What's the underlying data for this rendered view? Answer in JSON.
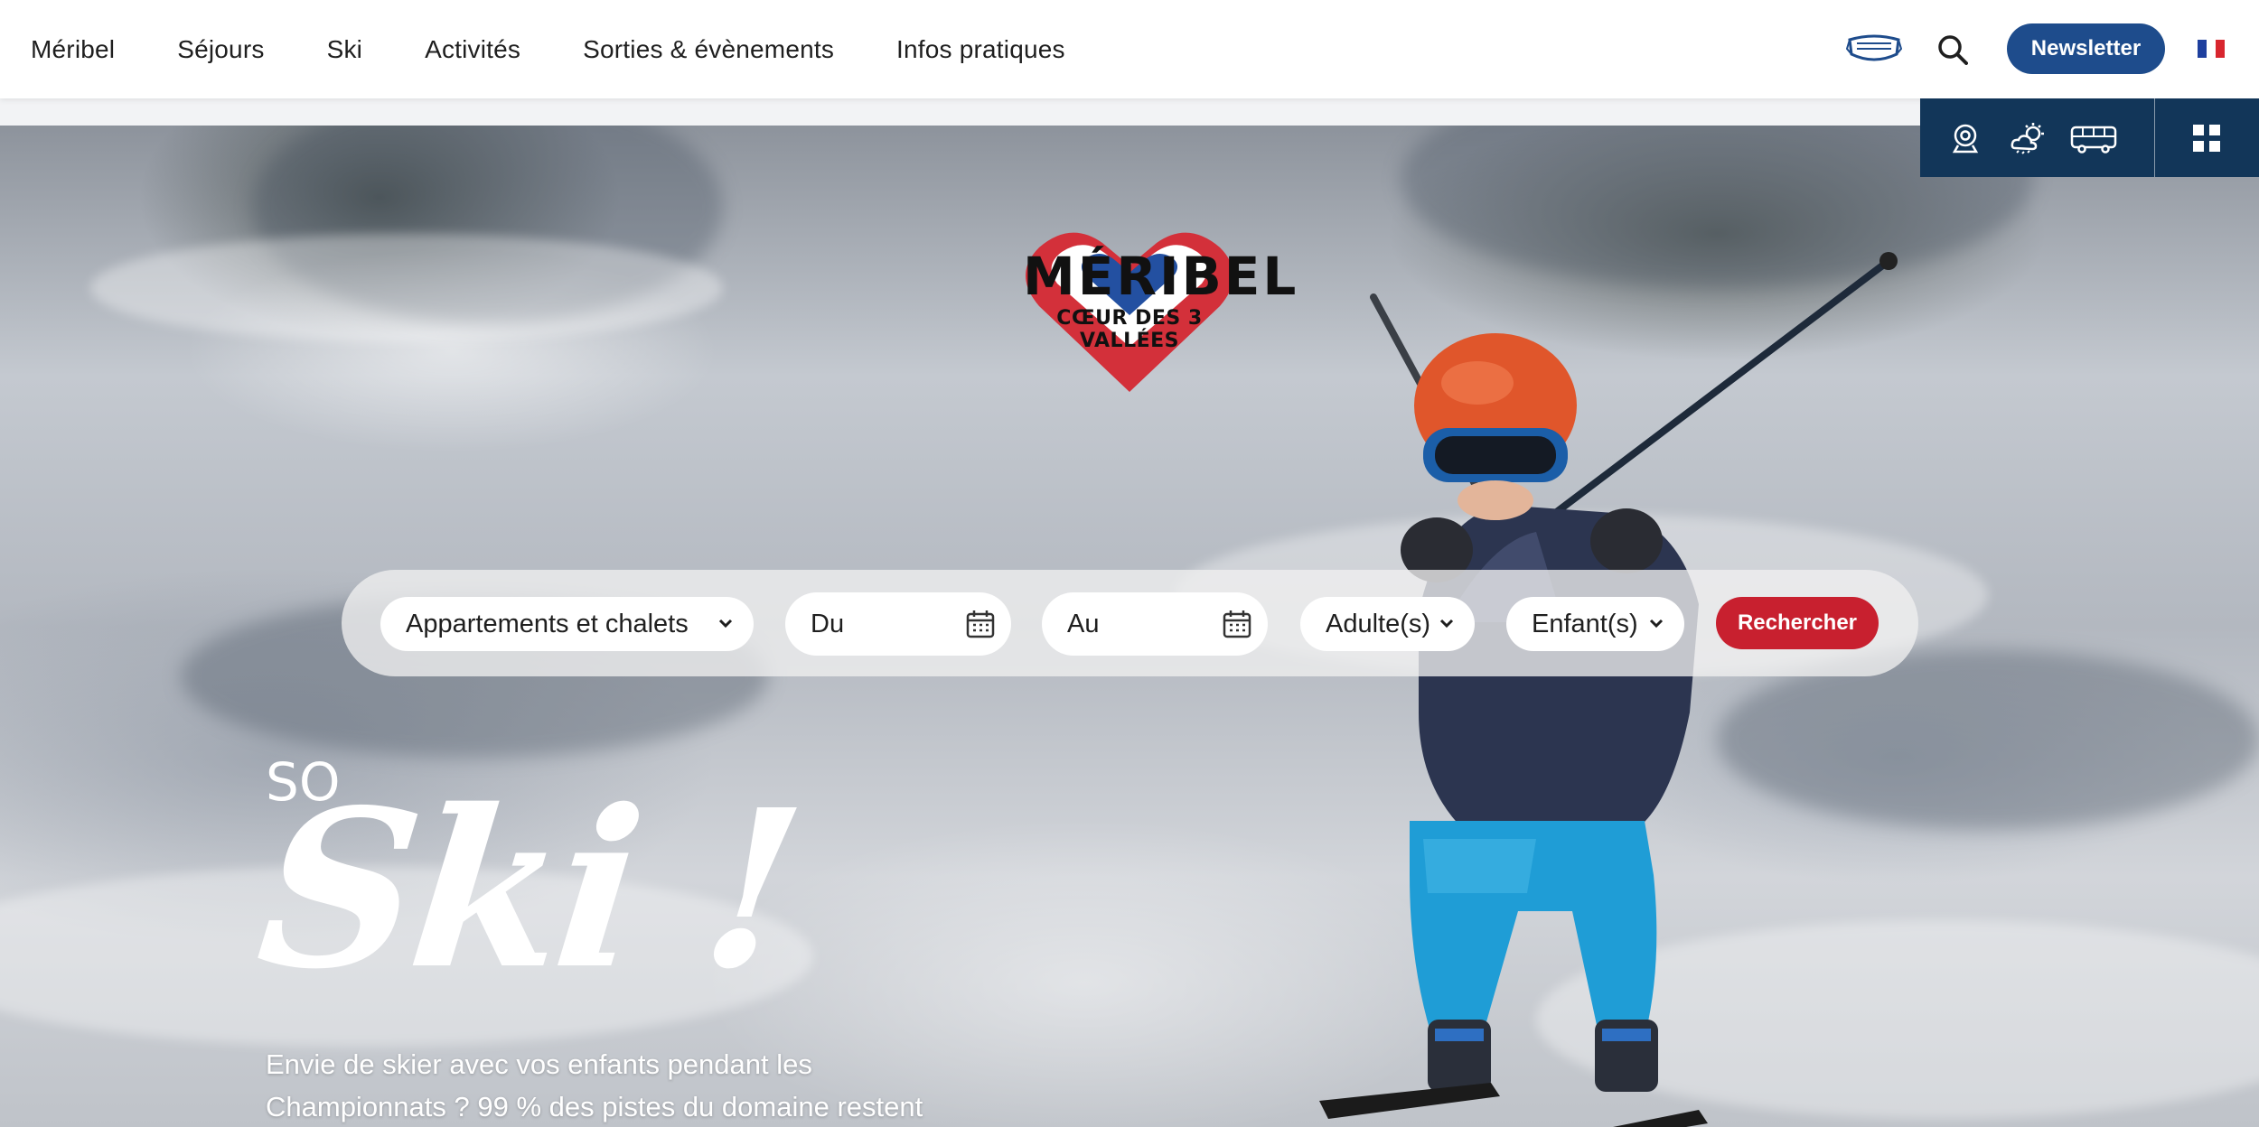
{
  "nav": {
    "items": [
      {
        "label": "Méribel"
      },
      {
        "label": "Séjours"
      },
      {
        "label": "Ski"
      },
      {
        "label": "Activités"
      },
      {
        "label": "Sorties & évènements"
      },
      {
        "label": "Infos pratiques"
      }
    ],
    "newsletter_label": "Newsletter",
    "icons": [
      "mask-icon",
      "search-icon",
      "flag-fr-icon"
    ],
    "colors": {
      "newsletter_bg": "#1e4c8c",
      "flag_blue": "#1e3f9e",
      "flag_red": "#d8262e"
    }
  },
  "quick_access": {
    "icons": [
      "webcam-icon",
      "weather-icon",
      "bus-icon",
      "grid-menu-icon"
    ],
    "background": "#123659"
  },
  "hero": {
    "logo_word": "MÉRIBEL",
    "logo_sub": "CŒUR DES 3 VALLÉES",
    "kicker": "SO",
    "script_title": "Ski !",
    "blurb_line1": "Envie de skier avec vos enfants pendant les",
    "blurb_line2": "Championnats ? 99 % des pistes du domaine restent"
  },
  "search": {
    "type_select": "Appartements et chalets",
    "date_from": "Du",
    "date_to": "Au",
    "adults": "Adulte(s)",
    "children": "Enfant(s)",
    "submit_label": "Rechercher",
    "submit_color": "#c8202f"
  }
}
